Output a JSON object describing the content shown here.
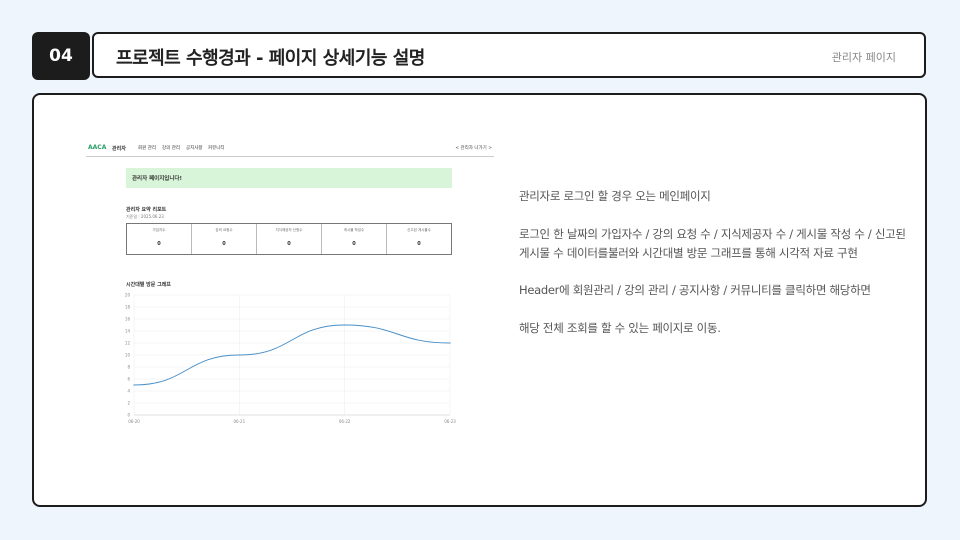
{
  "header": {
    "number": "04",
    "title": "프로젝트 수행경과 - 페이지 상세기능 설명",
    "subtitle": "관리자 페이지"
  },
  "screenshot": {
    "logo": "AACA",
    "brand": "관리자",
    "menu": [
      "회원 관리",
      "강의 관리",
      "공지사항",
      "커뮤니티"
    ],
    "logout": "< 관리자 나가기 >",
    "greeting": "관리자 페이지입니다!",
    "summary_title": "관리자 요약 리포트",
    "summary_date": "기준일 : 2025.06.23",
    "summary_cells": [
      {
        "label": "가입자수",
        "value": "0"
      },
      {
        "label": "강의 요청수",
        "value": "0"
      },
      {
        "label": "지식제공자 신청수",
        "value": "0"
      },
      {
        "label": "게시물 작성수",
        "value": "0"
      },
      {
        "label": "신고된 게시물수",
        "value": "0"
      }
    ],
    "graph_title": "시간대별 방문 그래프",
    "chart_data": {
      "type": "line",
      "x": [
        "06-20",
        "06-21",
        "06-22",
        "06-23"
      ],
      "series": [
        {
          "values": [
            5,
            10,
            15,
            12
          ]
        }
      ],
      "ylim": [
        0,
        20
      ],
      "yticks": [
        0,
        2,
        4,
        6,
        8,
        10,
        12,
        14,
        16,
        18,
        20
      ],
      "grid": true,
      "line_color": "#4a90c8"
    }
  },
  "description": [
    "관리자로 로그인 할 경우 오는 메인페이지",
    "로그인 한 날짜의 가입자수 / 강의 요청 수 / 지식제공자 수 / 게시물 작성 수 / 신고된",
    "게시물 수 데이터를불러와 시간대별 방문 그래프를 통해 시각적 자료 구현",
    "Header에 회원관리 / 강의 관리 / 공지사항 / 커뮤니티를 클릭하면 해당하면",
    "해당 전체 조회를 할 수 있는 페이지로 이동."
  ]
}
